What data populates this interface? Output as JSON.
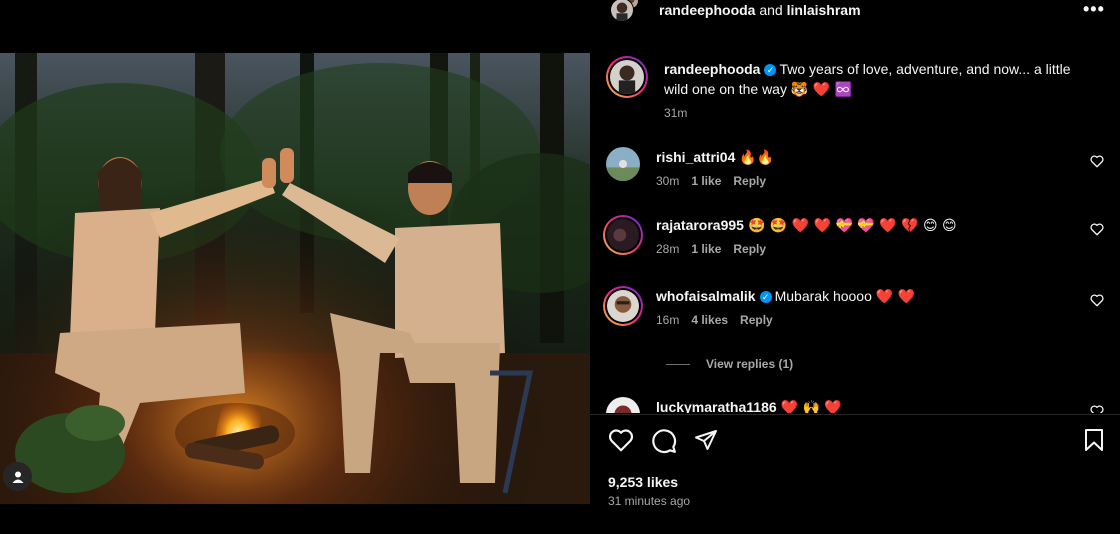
{
  "post": {
    "author": "randeephooda",
    "collaborator": "linlaishram",
    "joiner": "and",
    "more": "•••"
  },
  "caption": {
    "user": "randeephooda",
    "text": "Two years of love, adventure, and now... a little wild one on the way",
    "emojis": "🐯 ❤️ ♾️",
    "time": "31m"
  },
  "comments": [
    {
      "user": "rishi_attri04",
      "verified": false,
      "text": "",
      "emojis": "🔥🔥",
      "time": "30m",
      "likes": "1 like",
      "reply": "Reply"
    },
    {
      "user": "rajatarora995",
      "verified": false,
      "text": "",
      "emojis": "🤩 🤩 ❤️ ❤️ 💝 💝 ❤️ 💔 😊 😊",
      "time": "28m",
      "likes": "1 like",
      "reply": "Reply"
    },
    {
      "user": "whofaisalmalik",
      "verified": true,
      "text": "Mubarak hoooo",
      "emojis": "❤️ ❤️",
      "time": "16m",
      "likes": "4 likes",
      "reply": "Reply"
    },
    {
      "user": "luckymaratha1186",
      "verified": false,
      "text": "",
      "emojis": "❤️ 🙌 ❤️"
    }
  ],
  "view_replies": "View replies (1)",
  "likes_count": "9,253 likes",
  "posted_ago": "31 minutes ago",
  "colors": {
    "verified": "#0095f6",
    "muted": "#a8a8a8",
    "background": "#000000"
  }
}
